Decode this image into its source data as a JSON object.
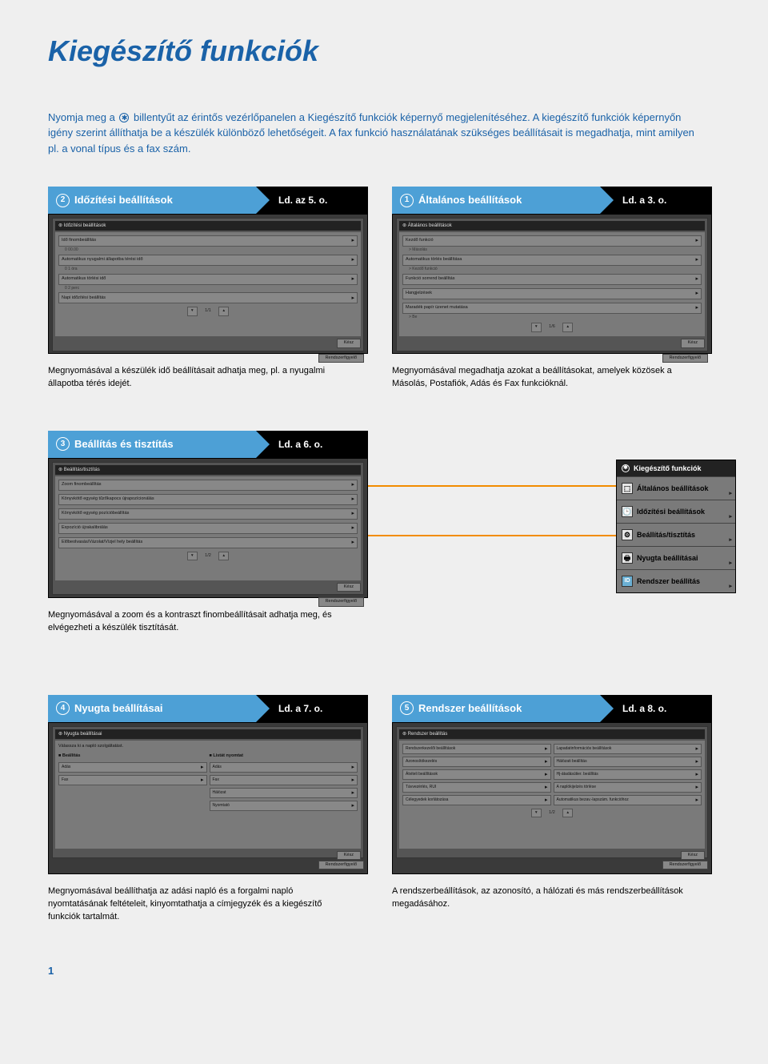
{
  "page_title": "Kiegészítő funkciók",
  "intro_parts": {
    "p1a": "Nyomja meg a ",
    "p1b": " billentyűt az érintős vezérlőpanelen a Kiegészítő funkciók képernyő megjelenítéséhez. A kiegészítő funkciók képernyőn igény szerint állíthatja be a készülék különböző lehetőségeit. A fax funkció használatának szükséges beállításait is megadhatja, mint amilyen pl. a vonal típus és a fax szám."
  },
  "sections": {
    "s2": {
      "num": "2",
      "title": "Időzítési beállítások",
      "ref": "Ld. az 5. o."
    },
    "s1": {
      "num": "1",
      "title": "Általános beállítások",
      "ref": "Ld. a 3. o."
    },
    "s3": {
      "num": "3",
      "title": "Beállítás és tisztítás",
      "ref": "Ld. a 6. o."
    },
    "s4": {
      "num": "4",
      "title": "Nyugta beállításai",
      "ref": "Ld. a 7. o."
    },
    "s5": {
      "num": "5",
      "title": "Rendszer beállítások",
      "ref": "Ld. a 8. o."
    }
  },
  "captions": {
    "c2": "Megnyomásával a készülék idő beállításait adhatja meg, pl. a nyugalmi állapotba térés idejét.",
    "c1": "Megnyomásával megadhatja azokat a beállításokat, amelyek közösek a Másolás, Postafiók, Adás és Fax funkcióknál.",
    "c3": "Megnyomásával a zoom és a kontraszt finombeállításait adhatja meg, és elvégezheti a készülék tisztítását.",
    "c4": "Megnyomásával beállíthatja az adási napló és a forgalmi napló nyomtatásának feltételeit, kinyomtathatja a címjegyzék és a kiegészítő funkciók tartalmát.",
    "c5": "A rendszerbeállítások, az azonosító, a hálózati és más rendszerbeállítások megadásához."
  },
  "mock": {
    "panel2_title": "Időzítési beállítások",
    "panel2_items": [
      {
        "label": "Idő finombeállítás",
        "sub": "0 00.00"
      },
      {
        "label": "Automatikus nyugalmi állapotba térési idő",
        "sub": "0 1 óra"
      },
      {
        "label": "Automatikus törlési idő",
        "sub": "0 2 perc"
      },
      {
        "label": "Napi időzítési beállítás",
        "sub": ""
      }
    ],
    "panel1_title": "Általános beállítások",
    "panel1_items": [
      {
        "label": "Kezdő funkció",
        "sub": "> Másolás"
      },
      {
        "label": "Automatikus törlés beállítása",
        "sub": "> Kezdő funkció"
      },
      {
        "label": "Funkció sorrend beállítás",
        "sub": ""
      },
      {
        "label": "Hangjelzések",
        "sub": ""
      },
      {
        "label": "Maradék papír üzenet mutatása",
        "sub": "> Be"
      }
    ],
    "panel3_title": "Beállítás/tisztítás",
    "panel3_items": [
      {
        "label": "Zoom finombeállítás"
      },
      {
        "label": "Könyvkötő egység tűzőkapocs újrapozícionálás"
      },
      {
        "label": "Könyvkötő egység pozícióbeállítás"
      },
      {
        "label": "Expozíció újrakalibrálás"
      },
      {
        "label": "Előbeolvasás/Vázolat/Vízjel hely beállítás"
      }
    ],
    "panel4_title": "Nyugta beállításai",
    "panel4_subtitle": "Válassza ki a napló szolgáltatást.",
    "panel4_col1_header": "■ Beállítás",
    "panel4_col2_header": "■ Listát nyomtat",
    "panel4_col1": [
      "Adás",
      "Fax"
    ],
    "panel4_col2": [
      "Adás",
      "Fax",
      "Hálózat",
      "Nyomtató"
    ],
    "panel5_title": "Rendszer beállítás",
    "panel5_items_l": [
      "Rendszerkezelői beállítások",
      "Azonosítókezelés",
      "Átviteli beállítások",
      "Távvezérlés, RUI",
      "Célegyedek korlátozása"
    ],
    "panel5_items_r": [
      "Lapadatinformációs beállítások",
      "Hálózati beállítás",
      "Hj-átadásútier. beállítás",
      "A naplókijelzés törlése",
      "Automatikus bezav.-lapszám. funkcióhoz"
    ],
    "kesz": "Kész",
    "rendszerfigyelo": "Rendszerfigyelő",
    "page_1_1": "1/1",
    "page_1_6": "1/6",
    "page_1_2": "1/2"
  },
  "side_menu": {
    "title": "Kiegészítő funkciók",
    "items": [
      {
        "icon": "⬚",
        "label": "Általános beállítások"
      },
      {
        "icon": "🕒",
        "label": "Időzítési beállítások"
      },
      {
        "icon": "⚙",
        "label": "Beállítás/tisztítás"
      },
      {
        "icon": "🖶",
        "label": "Nyugta beállításai"
      },
      {
        "icon": "ID",
        "label": "Rendszer beállítás"
      }
    ]
  },
  "page_number": "1"
}
